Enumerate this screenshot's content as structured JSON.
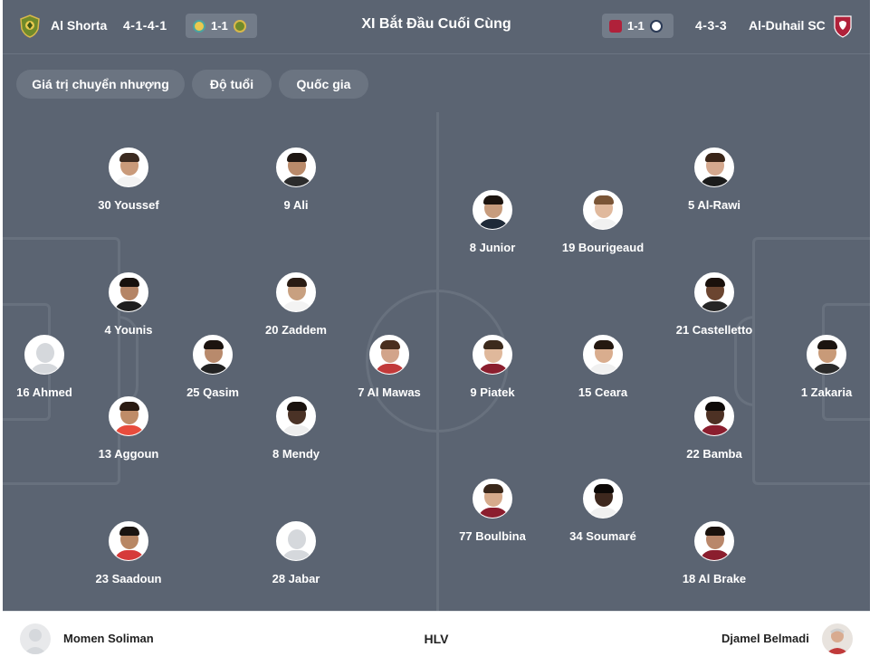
{
  "header": {
    "home": {
      "name": "Al Shorta",
      "formation": "4-1-4-1",
      "score": "1-1"
    },
    "title": "XI Bắt Đầu Cuối Cùng",
    "away": {
      "name": "Al-Duhail SC",
      "formation": "4-3-3",
      "score": "1-1"
    }
  },
  "filters": [
    "Giá trị chuyển nhượng",
    "Độ tuổi",
    "Quốc gia"
  ],
  "home_players": [
    {
      "label": "30 Youssef",
      "skin": "#c99a7a",
      "hair": "#3b2a20",
      "shirt": "#f2f2f2"
    },
    {
      "label": "9 Ali",
      "skin": "#b98a6a",
      "hair": "#1e1612",
      "shirt": "#2c2c2c"
    },
    {
      "label": "4 Younis",
      "skin": "#b58566",
      "hair": "#17110d",
      "shirt": "#1f1f1f"
    },
    {
      "label": "20 Zaddem",
      "skin": "#c8a080",
      "hair": "#2a1c14",
      "shirt": "#f3f3f3"
    },
    {
      "label": "16 Ahmed",
      "placeholder": true
    },
    {
      "label": "25 Qasim",
      "skin": "#b88a6c",
      "hair": "#1b130f",
      "shirt": "#222222"
    },
    {
      "label": "7 Al Mawas",
      "skin": "#d2a48a",
      "hair": "#4a2e1e",
      "shirt": "#c23a3a"
    },
    {
      "label": "13 Aggoun",
      "skin": "#bf8c68",
      "hair": "#2b1b12",
      "shirt": "#e84c3d"
    },
    {
      "label": "8 Mendy",
      "skin": "#4a3226",
      "hair": "#1a120e",
      "shirt": "#ededed"
    },
    {
      "label": "23 Saadoun",
      "skin": "#b88764",
      "hair": "#1a1410",
      "shirt": "#d63a3a"
    },
    {
      "label": "28 Jabar",
      "placeholder": true
    }
  ],
  "away_players": [
    {
      "label": "5 Al-Rawi",
      "skin": "#d4a88e",
      "hair": "#3a2518",
      "shirt": "#1b1b1b"
    },
    {
      "label": "8 Junior",
      "skin": "#c79c7d",
      "hair": "#1c140f",
      "shirt": "#1f2a38"
    },
    {
      "label": "19 Bourigeaud",
      "skin": "#e0b99d",
      "hair": "#7a5536",
      "shirt": "#f1f1f1"
    },
    {
      "label": "21 Castelletto",
      "skin": "#6b4530",
      "hair": "#1a110c",
      "shirt": "#262626"
    },
    {
      "label": "1 Zakaria",
      "skin": "#c89a78",
      "hair": "#1b1410",
      "shirt": "#2a2a2a"
    },
    {
      "label": "9 Piatek",
      "skin": "#dfb89b",
      "hair": "#3c2a1c",
      "shirt": "#8b1e2e"
    },
    {
      "label": "15 Ceara",
      "skin": "#d9ad8e",
      "hair": "#241810",
      "shirt": "#f0f0f0"
    },
    {
      "label": "22 Bamba",
      "skin": "#4d3124",
      "hair": "#0f0a08",
      "shirt": "#8b1e2e"
    },
    {
      "label": "77 Boulbina",
      "skin": "#d6ab8c",
      "hair": "#3a271a",
      "shirt": "#8b1e2e"
    },
    {
      "label": "34 Soumaré",
      "skin": "#3e281e",
      "hair": "#0d0907",
      "shirt": "#f0f0f0"
    },
    {
      "label": "18 Al Brake",
      "skin": "#b9876a",
      "hair": "#1a120d",
      "shirt": "#8b1e2e"
    }
  ],
  "footer": {
    "home_coach": "Momen Soliman",
    "label": "HLV",
    "away_coach": "Djamel Belmadi"
  },
  "colors": {
    "pitch": "#5b6472",
    "pitch_lines": "#68717e",
    "home_crest": "#6f8a2a",
    "away_crest": "#b0213a"
  },
  "icons": [
    "al-shorta-crest-icon",
    "al-duhail-crest-icon",
    "player-placeholder-icon"
  ]
}
